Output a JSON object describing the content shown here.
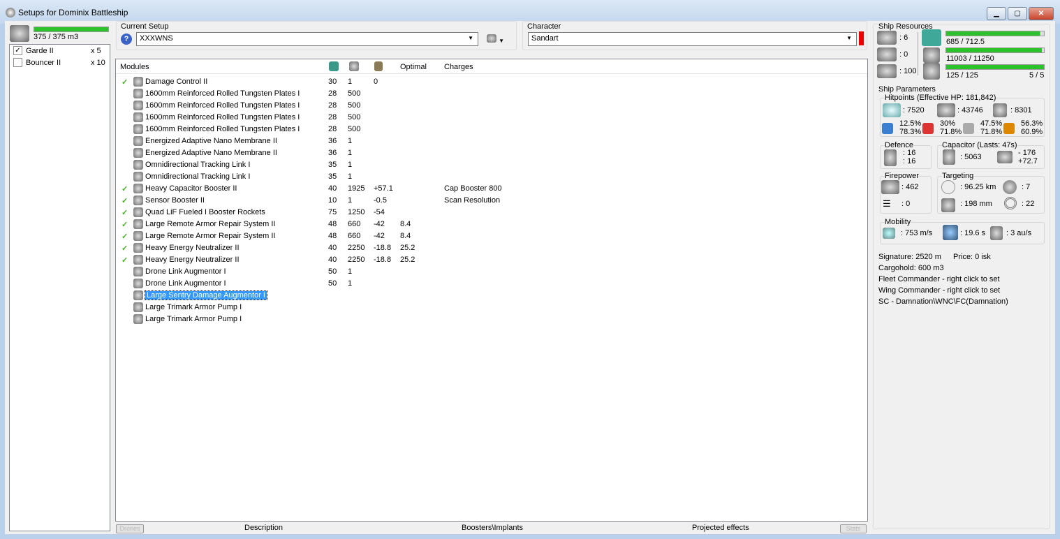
{
  "window": {
    "title": "Setups for Dominix Battleship",
    "min": "▁",
    "max": "▢",
    "close": "✕"
  },
  "drones": {
    "bay": "375 / 375 m3",
    "bay_fraction": 1.0,
    "items": [
      {
        "name": "Garde II",
        "qty": "x 5",
        "checked": true
      },
      {
        "name": "Bouncer II",
        "qty": "x 10",
        "checked": false
      }
    ]
  },
  "setup": {
    "label": "Current Setup",
    "value": "XXXWNS",
    "help": "?"
  },
  "character": {
    "label": "Character",
    "value": "Sandart"
  },
  "modules": {
    "headers": {
      "name": "Modules",
      "optimal": "Optimal",
      "charges": "Charges"
    },
    "rows": [
      {
        "active": true,
        "name": "Damage Control II",
        "cpu": "30",
        "pg": "1",
        "cap": "0",
        "optimal": "",
        "charges": ""
      },
      {
        "active": false,
        "name": "1600mm Reinforced Rolled Tungsten Plates I",
        "cpu": "28",
        "pg": "500",
        "cap": "",
        "optimal": "",
        "charges": ""
      },
      {
        "active": false,
        "name": "1600mm Reinforced Rolled Tungsten Plates I",
        "cpu": "28",
        "pg": "500",
        "cap": "",
        "optimal": "",
        "charges": ""
      },
      {
        "active": false,
        "name": "1600mm Reinforced Rolled Tungsten Plates I",
        "cpu": "28",
        "pg": "500",
        "cap": "",
        "optimal": "",
        "charges": ""
      },
      {
        "active": false,
        "name": "1600mm Reinforced Rolled Tungsten Plates I",
        "cpu": "28",
        "pg": "500",
        "cap": "",
        "optimal": "",
        "charges": ""
      },
      {
        "active": false,
        "name": "Energized Adaptive Nano Membrane II",
        "cpu": "36",
        "pg": "1",
        "cap": "",
        "optimal": "",
        "charges": ""
      },
      {
        "active": false,
        "name": "Energized Adaptive Nano Membrane II",
        "cpu": "36",
        "pg": "1",
        "cap": "",
        "optimal": "",
        "charges": ""
      },
      {
        "active": false,
        "name": "Omnidirectional Tracking Link I",
        "cpu": "35",
        "pg": "1",
        "cap": "",
        "optimal": "",
        "charges": ""
      },
      {
        "active": false,
        "name": "Omnidirectional Tracking Link I",
        "cpu": "35",
        "pg": "1",
        "cap": "",
        "optimal": "",
        "charges": ""
      },
      {
        "active": true,
        "name": "Heavy Capacitor Booster II",
        "cpu": "40",
        "pg": "1925",
        "cap": "+57.1",
        "optimal": "",
        "charges": "Cap Booster 800"
      },
      {
        "active": true,
        "name": "Sensor Booster II",
        "cpu": "10",
        "pg": "1",
        "cap": "-0.5",
        "optimal": "",
        "charges": "Scan Resolution"
      },
      {
        "active": true,
        "name": "Quad LiF Fueled I Booster Rockets",
        "cpu": "75",
        "pg": "1250",
        "cap": "-54",
        "optimal": "",
        "charges": ""
      },
      {
        "active": true,
        "name": "Large Remote Armor Repair System II",
        "cpu": "48",
        "pg": "660",
        "cap": "-42",
        "optimal": "8.4",
        "charges": ""
      },
      {
        "active": true,
        "name": "Large Remote Armor Repair System II",
        "cpu": "48",
        "pg": "660",
        "cap": "-42",
        "optimal": "8.4",
        "charges": ""
      },
      {
        "active": true,
        "name": "Heavy Energy Neutralizer II",
        "cpu": "40",
        "pg": "2250",
        "cap": "-18.8",
        "optimal": "25.2",
        "charges": ""
      },
      {
        "active": true,
        "name": "Heavy Energy Neutralizer II",
        "cpu": "40",
        "pg": "2250",
        "cap": "-18.8",
        "optimal": "25.2",
        "charges": ""
      },
      {
        "active": false,
        "name": "Drone Link Augmentor I",
        "cpu": "50",
        "pg": "1",
        "cap": "",
        "optimal": "",
        "charges": ""
      },
      {
        "active": false,
        "name": "Drone Link Augmentor I",
        "cpu": "50",
        "pg": "1",
        "cap": "",
        "optimal": "",
        "charges": ""
      },
      {
        "active": false,
        "name": "Large Sentry Damage Augmentor I",
        "cpu": "",
        "pg": "",
        "cap": "",
        "optimal": "",
        "charges": "",
        "selected": true
      },
      {
        "active": false,
        "name": "Large Trimark Armor Pump I",
        "cpu": "",
        "pg": "",
        "cap": "",
        "optimal": "",
        "charges": ""
      },
      {
        "active": false,
        "name": "Large Trimark Armor Pump I",
        "cpu": "",
        "pg": "",
        "cap": "",
        "optimal": "",
        "charges": ""
      }
    ]
  },
  "tabs": {
    "drones": "Drones",
    "description": "Description",
    "boosters": "Boosters\\Implants",
    "projected": "Projected effects",
    "stats": "Stats"
  },
  "resources": {
    "title": "Ship Resources",
    "turrets": ": 6",
    "launchers": ": 0",
    "drone_bw": ": 100",
    "cpu": "685 / 712.5",
    "cpu_fraction": 0.961,
    "pg": "11003 / 11250",
    "pg_fraction": 0.978,
    "drone": "125 / 125",
    "drone_fraction": 1.0,
    "drones_active": "5 / 5"
  },
  "params": {
    "title": "Ship Parameters",
    "hp_title": "Hitpoints (Effective HP: 181,842)",
    "shield": ": 7520",
    "armor": ": 43746",
    "hull": ": 8301",
    "res": [
      [
        "12.5%",
        "78.3%"
      ],
      [
        "30%",
        "71.8%"
      ],
      [
        "47.5%",
        "71.8%"
      ],
      [
        "56.3%",
        "60.9%"
      ]
    ],
    "defence_title": "Defence",
    "def1": ": 16",
    "def2": ": 16",
    "cap_title": "Capacitor (Lasts: 47s)",
    "cap": ": 5063",
    "cap_use": "- 176",
    "cap_rech": "+72.7",
    "fp_title": "Firepower",
    "dps": ": 462",
    "volley": ": 0",
    "tgt_title": "Targeting",
    "range": ": 96.25 km",
    "targets": ": 7",
    "scanres": ": 198 mm",
    "sensor": ": 22",
    "mob_title": "Mobility",
    "speed": ": 753 m/s",
    "align": ": 19.6 s",
    "warp": ": 3 au/s"
  },
  "info": [
    "Signature: 2520 m",
    "Price: 0 isk",
    "Cargohold: 600 m3",
    "Fleet Commander - right click to set",
    "Wing Commander - right click to set",
    "SC - Damnation\\WNC\\FC(Damnation)"
  ]
}
